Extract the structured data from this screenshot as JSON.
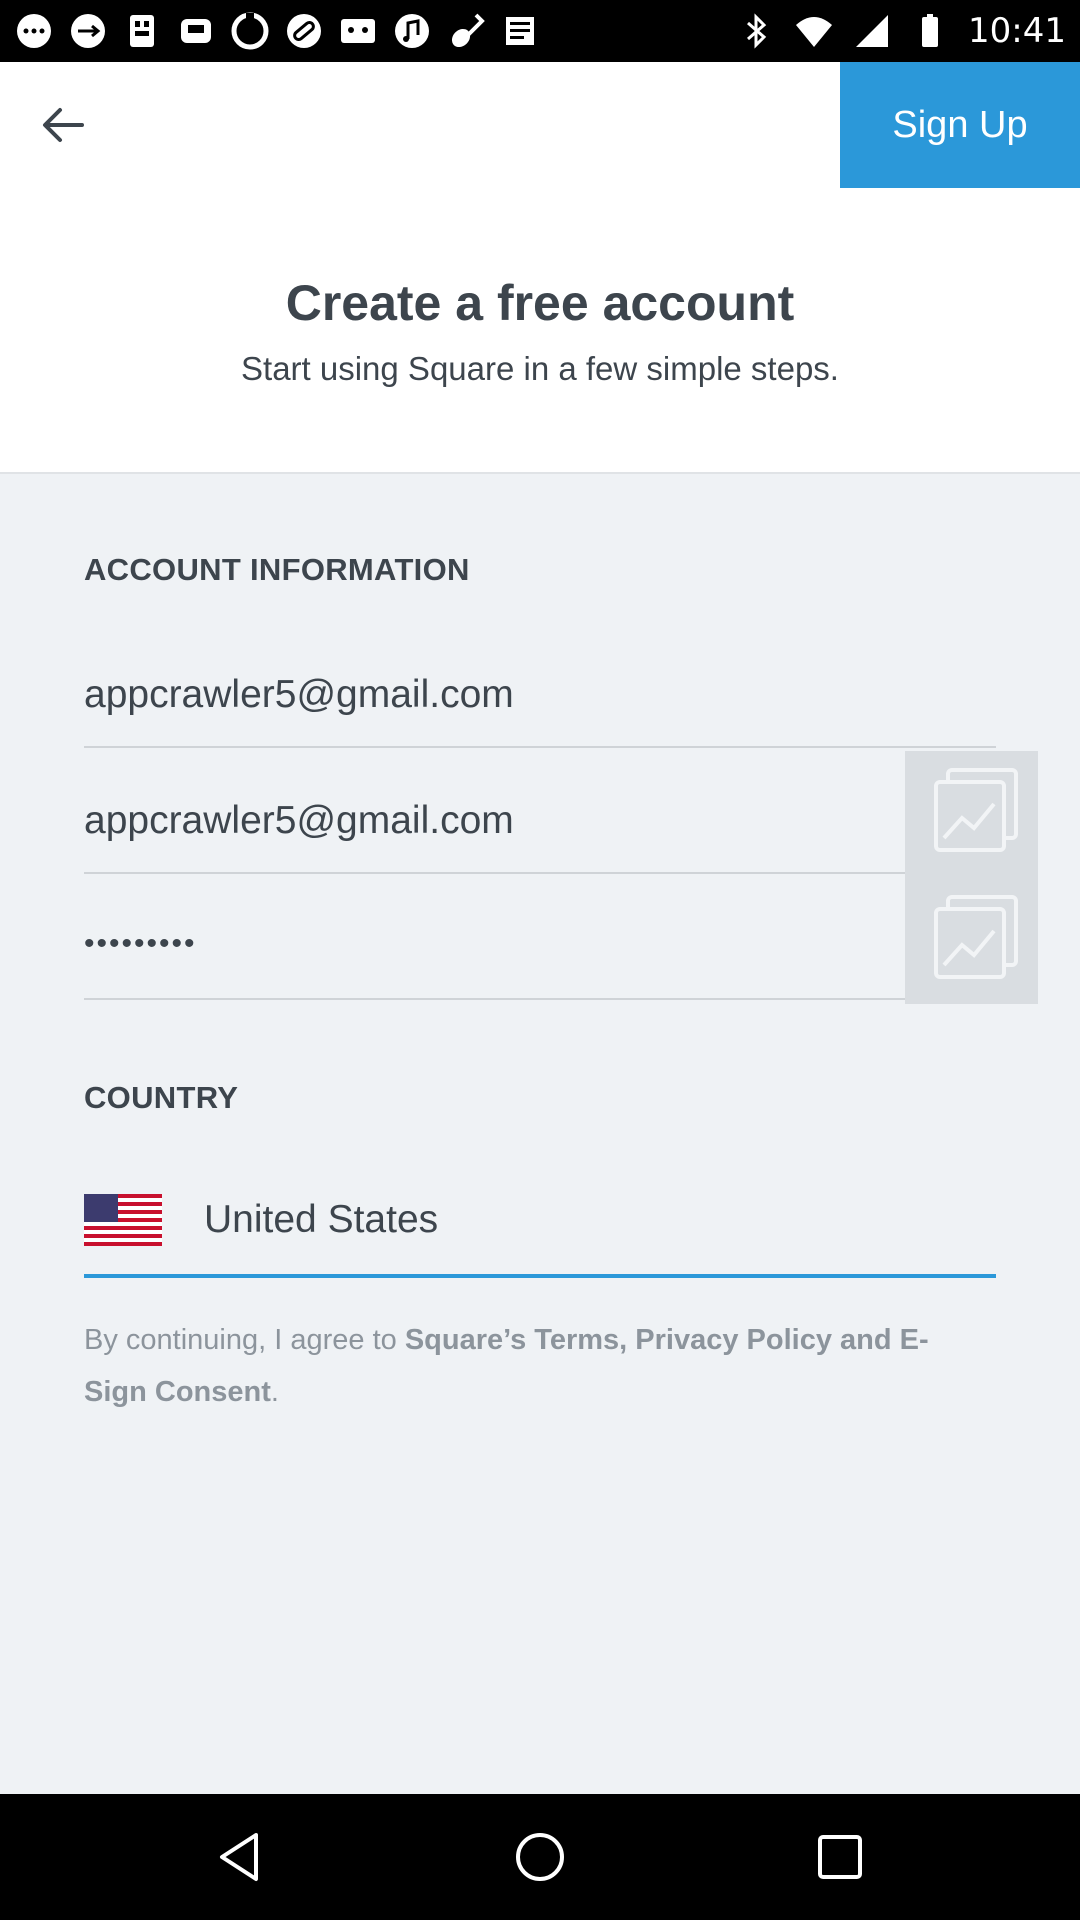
{
  "status_bar": {
    "time": "10:41",
    "icons": [
      "messages-icon",
      "usb-icon",
      "flashlight-icon",
      "phone-icon",
      "sync-icon",
      "link-icon",
      "cassette-icon",
      "music-icon",
      "guitar-icon",
      "news-icon"
    ]
  },
  "top_bar": {
    "back_icon": "arrow-left-icon",
    "signup_label": "Sign Up"
  },
  "header": {
    "title": "Create a free account",
    "subtitle": "Start using Square in a few simple steps."
  },
  "account_section": {
    "label": "ACCOUNT INFORMATION",
    "email": "appcrawler5@gmail.com",
    "confirm_email": "appcrawler5@gmail.com",
    "password": "•••••••••"
  },
  "country_section": {
    "label": "COUNTRY",
    "value": "United States",
    "flag_icon": "us-flag-icon"
  },
  "legal": {
    "prefix": "By continuing, I agree to ",
    "link": "Square’s Terms, Privacy Policy and E-Sign Consent",
    "suffix": "."
  },
  "colors": {
    "accent": "#2b98d9",
    "background": "#eff2f5",
    "text": "#3d454d",
    "muted": "#8c949c"
  }
}
